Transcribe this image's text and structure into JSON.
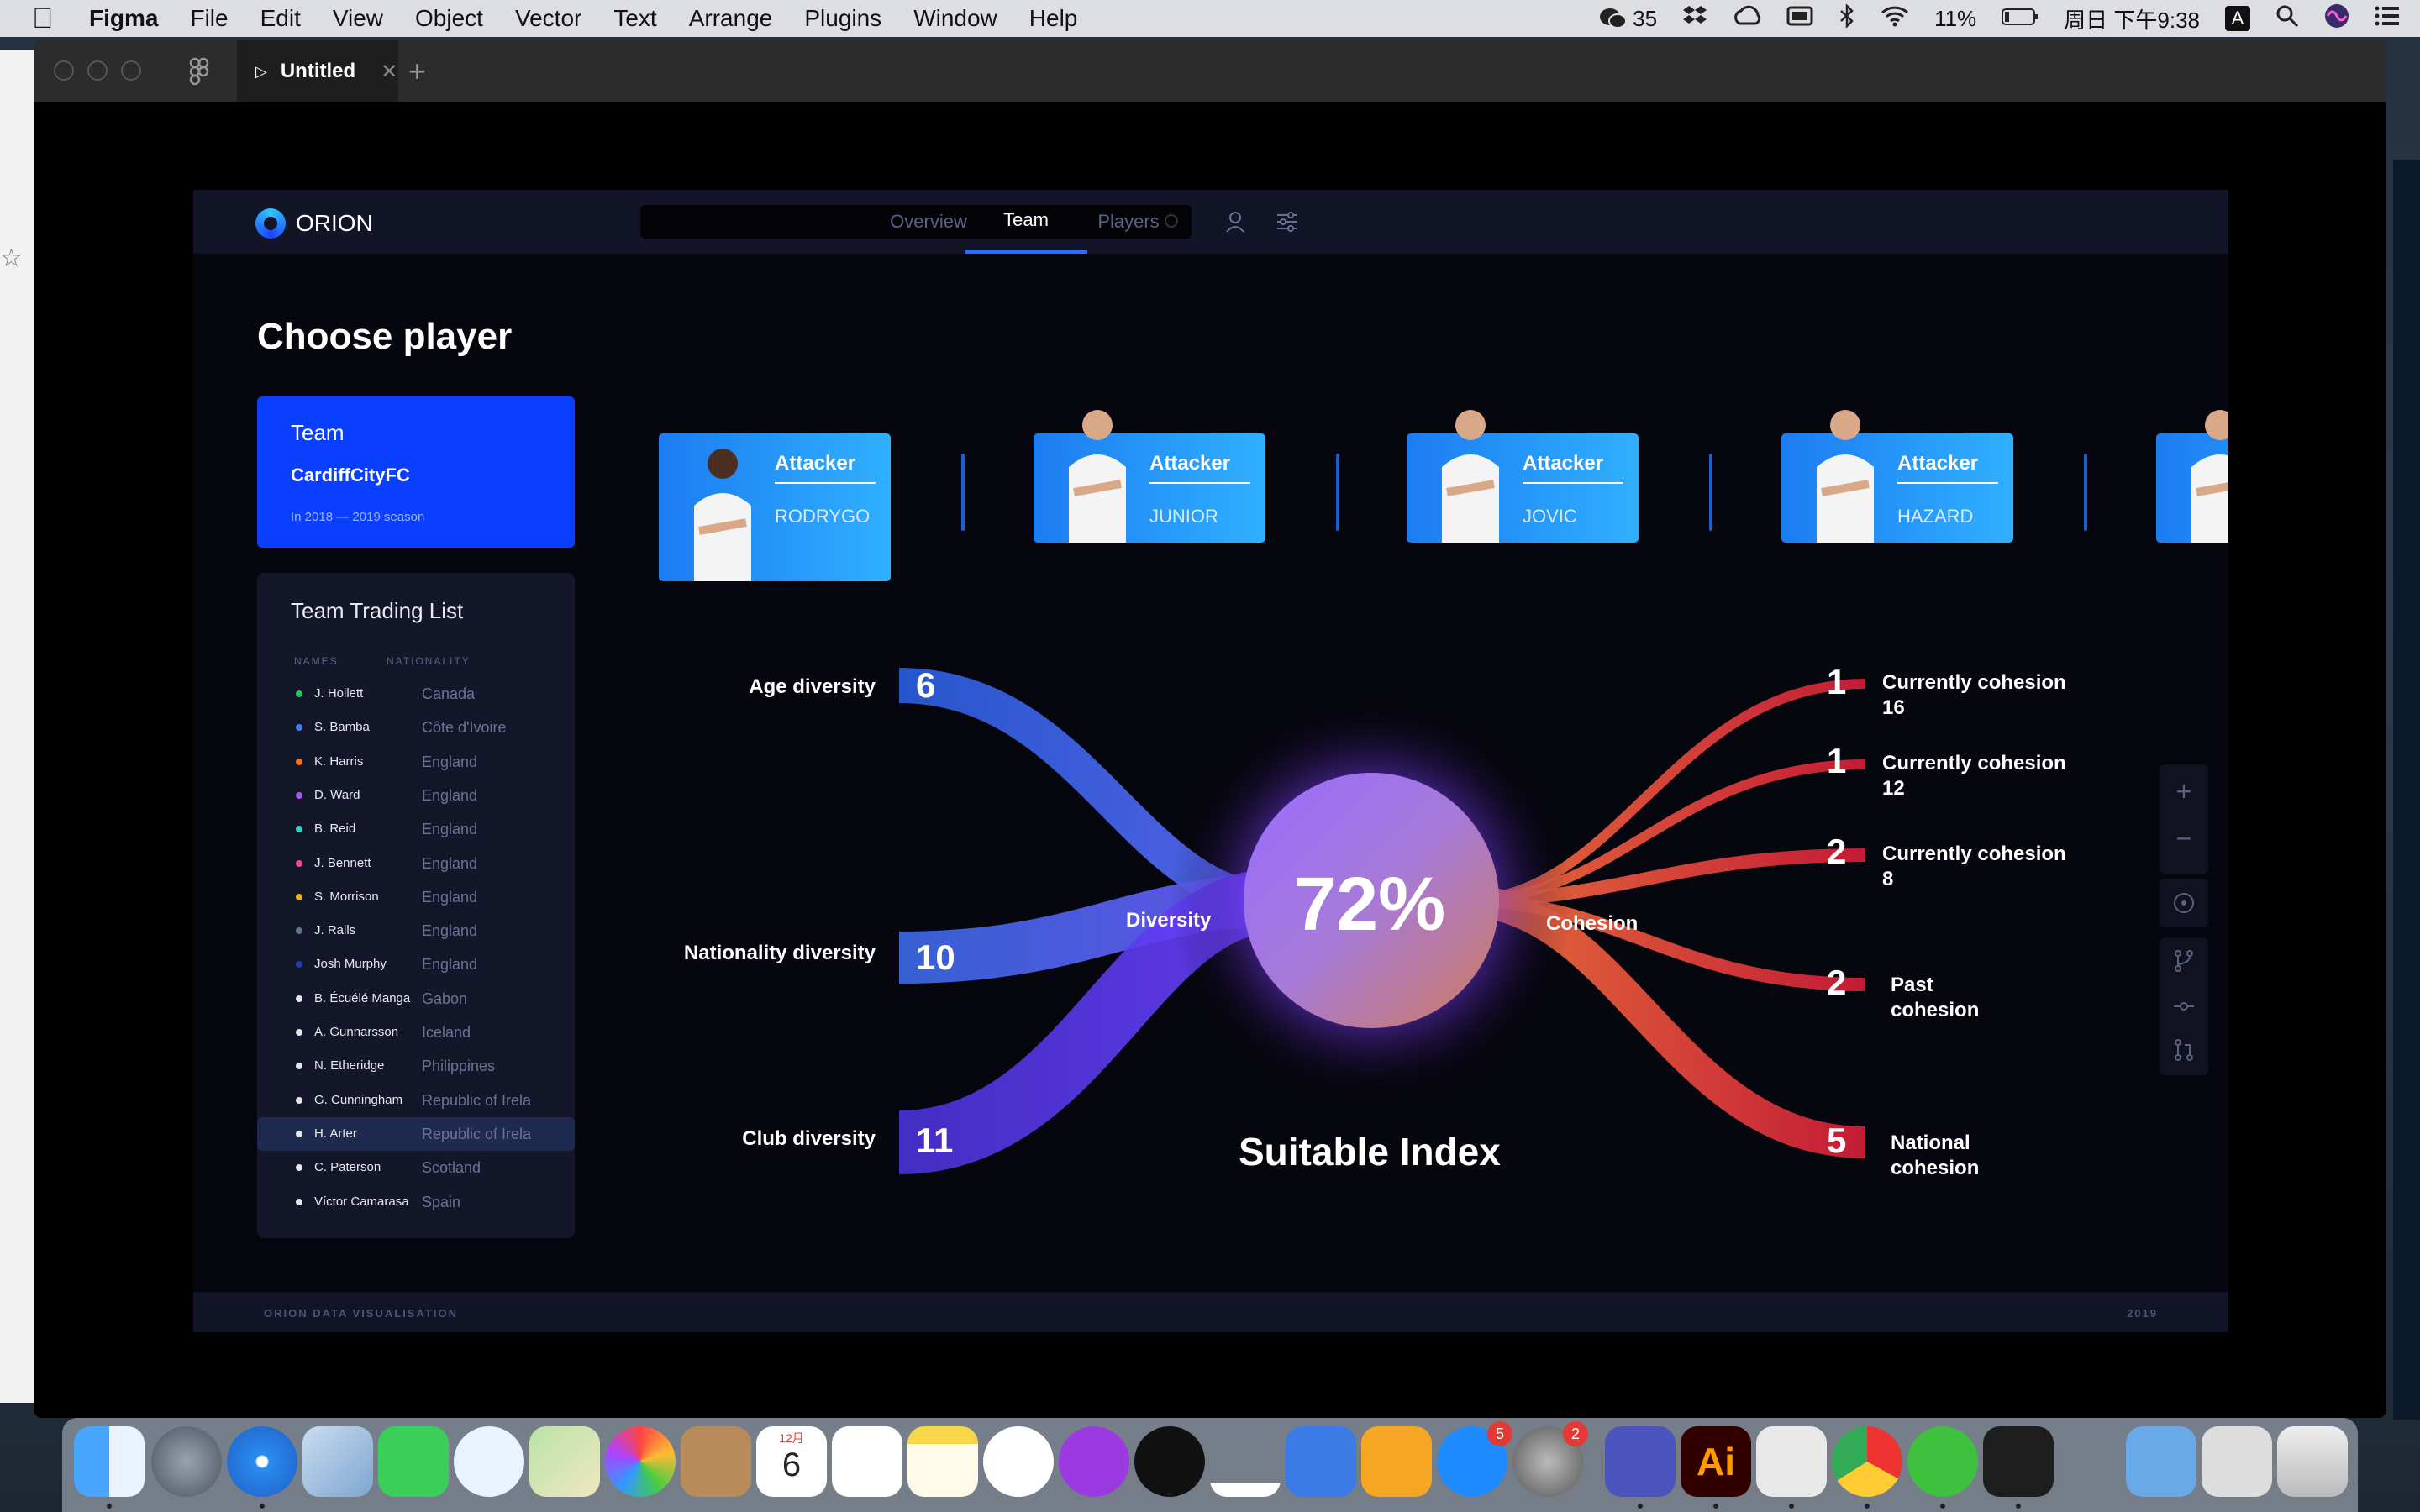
{
  "menubar": {
    "app": "Figma",
    "items": [
      "File",
      "Edit",
      "View",
      "Object",
      "Vector",
      "Text",
      "Arrange",
      "Plugins",
      "Window",
      "Help"
    ],
    "wechat_count": "35",
    "battery": "11%",
    "clock": "周日 下午9:38",
    "input_method": "A"
  },
  "figma": {
    "tab_title": "Untitled"
  },
  "app": {
    "brand": "ORION",
    "nav_tabs": [
      "Overview",
      "Team",
      "Players"
    ],
    "active_tab": "Team",
    "page_title": "Choose player",
    "team_card": {
      "label": "Team",
      "name": "CardiffCityFC",
      "season": "In 2018 — 2019 season"
    },
    "trading": {
      "title": "Team Trading List",
      "col_names": "NAMES",
      "col_nationality": "NATIONALITY",
      "rows": [
        {
          "name": "J. Hoilett",
          "nat": "Canada",
          "dot": "#22c55e"
        },
        {
          "name": "S. Bamba",
          "nat": "Côte d'Ivoire",
          "dot": "#3b82f6"
        },
        {
          "name": "K. Harris",
          "nat": "England",
          "dot": "#f97316"
        },
        {
          "name": "D. Ward",
          "nat": "England",
          "dot": "#a855f7"
        },
        {
          "name": "B. Reid",
          "nat": "England",
          "dot": "#2dd4bf"
        },
        {
          "name": "J. Bennett",
          "nat": "England",
          "dot": "#ec4899"
        },
        {
          "name": "S. Morrison",
          "nat": "England",
          "dot": "#eab308"
        },
        {
          "name": "J. Ralls",
          "nat": "England",
          "dot": "#64748b"
        },
        {
          "name": "Josh Murphy",
          "nat": "England",
          "dot": "#1e40af"
        },
        {
          "name": "B. Écuélé Manga",
          "nat": "Gabon",
          "dot": "#e5e7eb"
        },
        {
          "name": "A. Gunnarsson",
          "nat": "Iceland",
          "dot": "#e5e7eb"
        },
        {
          "name": "N. Etheridge",
          "nat": "Philippines",
          "dot": "#e5e7eb"
        },
        {
          "name": "G. Cunningham",
          "nat": "Republic of Irela",
          "dot": "#e5e7eb"
        },
        {
          "name": "H. Arter",
          "nat": "Republic of Irela",
          "dot": "#e5e7eb"
        },
        {
          "name": "C. Paterson",
          "nat": "Scotland",
          "dot": "#e5e7eb"
        },
        {
          "name": "Víctor Camarasa",
          "nat": "Spain",
          "dot": "#e5e7eb"
        }
      ],
      "selected": "H. Arter"
    },
    "players": [
      {
        "role": "Attacker",
        "name": "RODRYGO"
      },
      {
        "role": "Attacker",
        "name": "JUNIOR"
      },
      {
        "role": "Attacker",
        "name": "JOVIC"
      },
      {
        "role": "Attacker",
        "name": "HAZARD"
      },
      {
        "role": "",
        "name": ""
      }
    ],
    "viz": {
      "center_value": "72%",
      "center_caption": "Suitable Index",
      "left_hub": "Diversity",
      "right_hub": "Cohesion",
      "left_items": [
        {
          "label": "Age diversity",
          "value": "6"
        },
        {
          "label": "Nationality diversity",
          "value": "10"
        },
        {
          "label": "Club diversity",
          "value": "11"
        }
      ],
      "right_items": [
        {
          "value": "1",
          "line1": "Currently cohesion",
          "line2": "16"
        },
        {
          "value": "1",
          "line1": "Currently cohesion",
          "line2": "12"
        },
        {
          "value": "2",
          "line1": "Currently cohesion",
          "line2": "8"
        },
        {
          "value": "2",
          "line1": "Past",
          "line2": "cohesion"
        },
        {
          "value": "5",
          "line1": "National",
          "line2": "cohesion"
        }
      ]
    },
    "footer": {
      "left": "ORION DATA VISUALISATION",
      "right": "2019"
    }
  },
  "dock": {
    "calendar_month": "12月",
    "calendar_day": "6",
    "appstore_badge": "5",
    "prefs_badge": "2"
  },
  "colors": {
    "accent": "#0b3fff",
    "left_flow": "#3d6bff",
    "right_flow": "#e0304a"
  }
}
